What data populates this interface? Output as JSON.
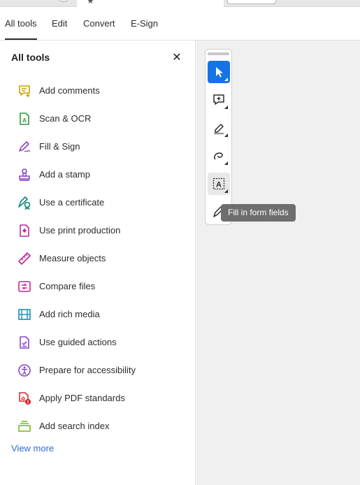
{
  "menubar": {
    "items": [
      "All tools",
      "Edit",
      "Convert",
      "E-Sign"
    ]
  },
  "panel": {
    "title": "All tools",
    "close_icon": "close-icon",
    "tools": [
      {
        "label": "Add comments",
        "icon": "comment-add-icon",
        "color": "#c9a300"
      },
      {
        "label": "Scan & OCR",
        "icon": "scan-ocr-icon",
        "color": "#2d9d3a"
      },
      {
        "label": "Fill & Sign",
        "icon": "fill-sign-icon",
        "color": "#8a45c9"
      },
      {
        "label": "Add a stamp",
        "icon": "stamp-icon",
        "color": "#8a45c9"
      },
      {
        "label": "Use a certificate",
        "icon": "certificate-icon",
        "color": "#0f8577"
      },
      {
        "label": "Use print production",
        "icon": "print-production-icon",
        "color": "#c2279c"
      },
      {
        "label": "Measure objects",
        "icon": "ruler-icon",
        "color": "#c2279c"
      },
      {
        "label": "Compare files",
        "icon": "compare-files-icon",
        "color": "#c2279c"
      },
      {
        "label": "Add rich media",
        "icon": "rich-media-icon",
        "color": "#1b8fb3"
      },
      {
        "label": "Use guided actions",
        "icon": "guided-actions-icon",
        "color": "#8a45c9"
      },
      {
        "label": "Prepare for accessibility",
        "icon": "accessibility-icon",
        "color": "#8a45c9"
      },
      {
        "label": "Apply PDF standards",
        "icon": "pdf-standards-icon",
        "color": "#d62b2b"
      },
      {
        "label": "Add search index",
        "icon": "search-index-icon",
        "color": "#7bbd2e"
      }
    ],
    "view_more": "View more"
  },
  "quick_toolbar": {
    "buttons": [
      "select-cursor-icon",
      "add-comment-icon",
      "highlight-icon",
      "freehand-draw-icon",
      "text-select-icon",
      "fill-sign-pen-icon"
    ],
    "selected_color": "#1473e6"
  },
  "tooltip": {
    "text": "Fill in form fields"
  }
}
